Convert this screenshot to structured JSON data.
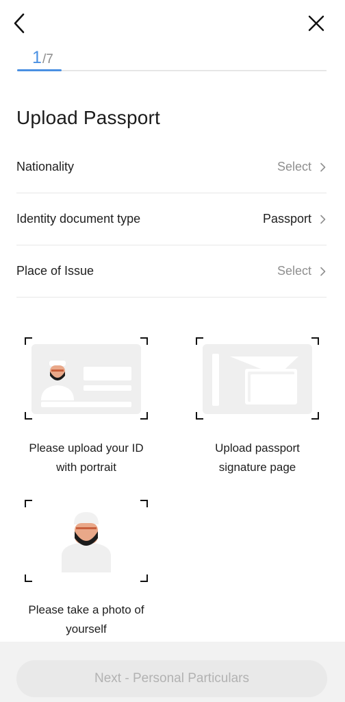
{
  "header": {
    "back_icon": "chevron-left-icon",
    "close_icon": "close-icon"
  },
  "stepper": {
    "current": "1",
    "total": "/7",
    "progress_fraction": 0.143,
    "accent_color": "#4a90e2"
  },
  "page": {
    "title": "Upload Passport"
  },
  "fields": [
    {
      "label": "Nationality",
      "value": "Select",
      "state": "placeholder"
    },
    {
      "label": "Identity document type",
      "value": "Passport",
      "state": "filled"
    },
    {
      "label": "Place of Issue",
      "value": "Select",
      "state": "placeholder"
    }
  ],
  "uploads": [
    {
      "icon": "id-card-icon",
      "caption_line1": "Please upload your ID",
      "caption_line2": "with portrait"
    },
    {
      "icon": "passport-icon",
      "caption_line1": "Upload passport",
      "caption_line2": "signature page"
    },
    {
      "icon": "selfie-icon",
      "caption_line1": "Please take a photo of",
      "caption_line2": "yourself"
    }
  ],
  "footer": {
    "next_label": "Next - Personal Particulars",
    "enabled": false
  }
}
